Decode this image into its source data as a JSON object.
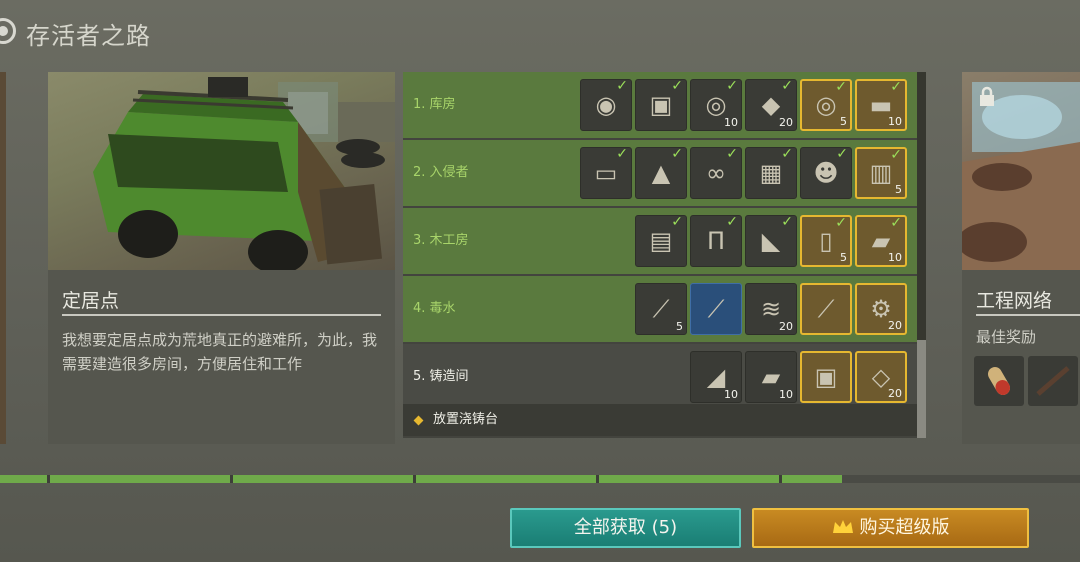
{
  "header": {
    "title": "存活者之路"
  },
  "main_card": {
    "title": "定居点",
    "description": "我想要定居点成为荒地真正的避难所，为此，我需要建造很多房间，方便居住和工作"
  },
  "tasks": [
    {
      "label": "1. 库房",
      "state": "done",
      "items": [
        {
          "icon": "mine-icon",
          "qty": "",
          "checked": true,
          "frame": "plain"
        },
        {
          "icon": "backpack-icon",
          "qty": "",
          "checked": true,
          "frame": "plain"
        },
        {
          "icon": "wire-spool-icon",
          "qty": "10",
          "checked": true,
          "frame": "plain"
        },
        {
          "icon": "metal-plate-icon",
          "qty": "20",
          "checked": true,
          "frame": "plain"
        },
        {
          "icon": "cable-reel-icon",
          "qty": "5",
          "checked": true,
          "frame": "gold"
        },
        {
          "icon": "wood-plank-icon",
          "qty": "10",
          "checked": true,
          "frame": "gold"
        }
      ]
    },
    {
      "label": "2. 入侵者",
      "state": "done",
      "items": [
        {
          "icon": "bag-icon",
          "qty": "",
          "checked": true,
          "frame": "plain"
        },
        {
          "icon": "pine-tree-icon",
          "qty": "",
          "checked": true,
          "frame": "plain"
        },
        {
          "icon": "goggles-icon",
          "qty": "",
          "checked": true,
          "frame": "plain"
        },
        {
          "icon": "armor-vest-icon",
          "qty": "",
          "checked": true,
          "frame": "plain"
        },
        {
          "icon": "gas-mask-icon",
          "qty": "",
          "checked": true,
          "frame": "plain"
        },
        {
          "icon": "filter-icon",
          "qty": "5",
          "checked": true,
          "frame": "gold"
        }
      ]
    },
    {
      "label": "3. 木工房",
      "state": "done",
      "items": [
        {
          "icon": "tool-rack-icon",
          "qty": "",
          "checked": true,
          "frame": "plain"
        },
        {
          "icon": "pants-icon",
          "qty": "",
          "checked": true,
          "frame": "plain"
        },
        {
          "icon": "boots-icon",
          "qty": "",
          "checked": true,
          "frame": "plain"
        },
        {
          "icon": "sack-icon",
          "qty": "5",
          "checked": true,
          "frame": "gold"
        },
        {
          "icon": "wood-block-icon",
          "qty": "10",
          "checked": true,
          "frame": "gold"
        }
      ]
    },
    {
      "label": "4. 毒水",
      "state": "done",
      "items": [
        {
          "icon": "spark-plug-icon",
          "qty": "5",
          "checked": false,
          "frame": "plain"
        },
        {
          "icon": "rifle-icon",
          "qty": "",
          "checked": false,
          "frame": "blue"
        },
        {
          "icon": "spring-icon",
          "qty": "20",
          "checked": false,
          "frame": "plain"
        },
        {
          "icon": "assault-rifle-icon",
          "qty": "",
          "checked": false,
          "frame": "gold"
        },
        {
          "icon": "engine-part-icon",
          "qty": "20",
          "checked": false,
          "frame": "gold"
        }
      ]
    },
    {
      "label": "5. 铸造间",
      "state": "current",
      "items": [
        {
          "icon": "iron-bar-icon",
          "qty": "10",
          "checked": false,
          "frame": "plain"
        },
        {
          "icon": "gold-plank-icon",
          "qty": "10",
          "checked": false,
          "frame": "plain"
        },
        {
          "icon": "chest-icon",
          "qty": "",
          "checked": false,
          "frame": "gold"
        },
        {
          "icon": "blueprint-icon",
          "qty": "20",
          "checked": false,
          "frame": "gold"
        }
      ]
    }
  ],
  "sub_task": {
    "label": "放置浇铸台"
  },
  "right_card": {
    "title": "工程网络",
    "subtitle": "最佳奖励"
  },
  "progress": {
    "fraction": 0.78
  },
  "buttons": {
    "claim_all": "全部获取 (5)",
    "buy_super": "购买超级版"
  },
  "colors": {
    "accent_green": "#6faa4a",
    "gold": "#e6b830",
    "teal": "#1f8a80"
  }
}
